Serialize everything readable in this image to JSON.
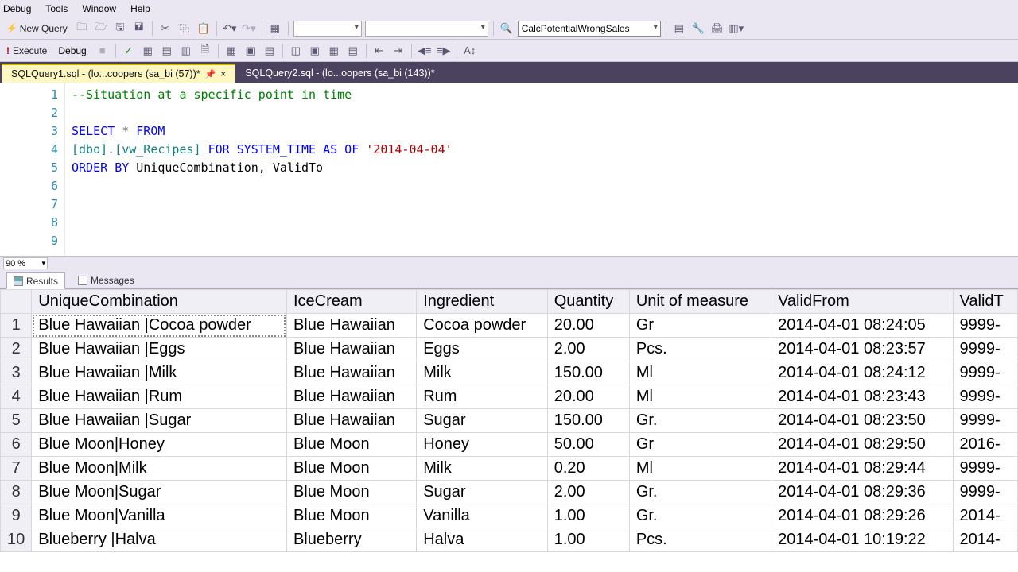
{
  "menus": {
    "debug": "Debug",
    "tools": "Tools",
    "window": "Window",
    "help": "Help"
  },
  "toolbar": {
    "new_query": "New Query",
    "execute": "Execute",
    "debug": "Debug",
    "object_dropdown": "CalcPotentialWrongSales"
  },
  "tabs": {
    "tab1": "SQLQuery1.sql - (lo...coopers (sa_bi (57))*",
    "tab2": "SQLQuery2.sql - (lo...oopers (sa_bi (143))*"
  },
  "editor": {
    "lines": [
      "1",
      "2",
      "3",
      "4",
      "5",
      "6",
      "7",
      "8",
      "9"
    ],
    "comment": "--Situation at a specific point in time",
    "select": "SELECT",
    "star": "*",
    "from": "FROM",
    "obj_open": "[dbo]",
    "obj_dot": ".",
    "obj_name": "[vw_Recipes]",
    "for": "FOR",
    "system_time": "SYSTEM_TIME",
    "as_of": "AS OF",
    "date": "'2014-04-04'",
    "order": "ORDER",
    "by": "BY",
    "obcols": " UniqueCombination, ValidTo",
    "zoom": "90 %"
  },
  "results": {
    "tab_results": "Results",
    "tab_messages": "Messages",
    "columns": [
      "UniqueCombination",
      "IceCream",
      "Ingredient",
      "Quantity",
      "Unit of measure",
      "ValidFrom",
      "ValidT"
    ],
    "rows": [
      [
        "Blue Hawaiian |Cocoa powder",
        "Blue Hawaiian",
        "Cocoa powder",
        "20.00",
        "Gr",
        "2014-04-01 08:24:05",
        "9999-"
      ],
      [
        "Blue Hawaiian |Eggs",
        "Blue Hawaiian",
        "Eggs",
        "2.00",
        "Pcs.",
        "2014-04-01 08:23:57",
        "9999-"
      ],
      [
        "Blue Hawaiian |Milk",
        "Blue Hawaiian",
        "Milk",
        "150.00",
        "Ml",
        "2014-04-01 08:24:12",
        "9999-"
      ],
      [
        "Blue Hawaiian |Rum",
        "Blue Hawaiian",
        "Rum",
        "20.00",
        "Ml",
        "2014-04-01 08:23:43",
        "9999-"
      ],
      [
        "Blue Hawaiian |Sugar",
        "Blue Hawaiian",
        "Sugar",
        "150.00",
        "Gr.",
        "2014-04-01 08:23:50",
        "9999-"
      ],
      [
        "Blue Moon|Honey",
        "Blue Moon",
        "Honey",
        "50.00",
        "Gr",
        "2014-04-01 08:29:50",
        "2016-"
      ],
      [
        "Blue Moon|Milk",
        "Blue Moon",
        "Milk",
        "0.20",
        "Ml",
        "2014-04-01 08:29:44",
        "9999-"
      ],
      [
        "Blue Moon|Sugar",
        "Blue Moon",
        "Sugar",
        "2.00",
        "Gr.",
        "2014-04-01 08:29:36",
        "9999-"
      ],
      [
        "Blue Moon|Vanilla",
        "Blue Moon",
        "Vanilla",
        "1.00",
        "Gr.",
        "2014-04-01 08:29:26",
        "2014-"
      ],
      [
        "Blueberry |Halva",
        "Blueberry",
        "Halva",
        "1.00",
        "Pcs.",
        "2014-04-01 10:19:22",
        "2014-"
      ]
    ]
  }
}
